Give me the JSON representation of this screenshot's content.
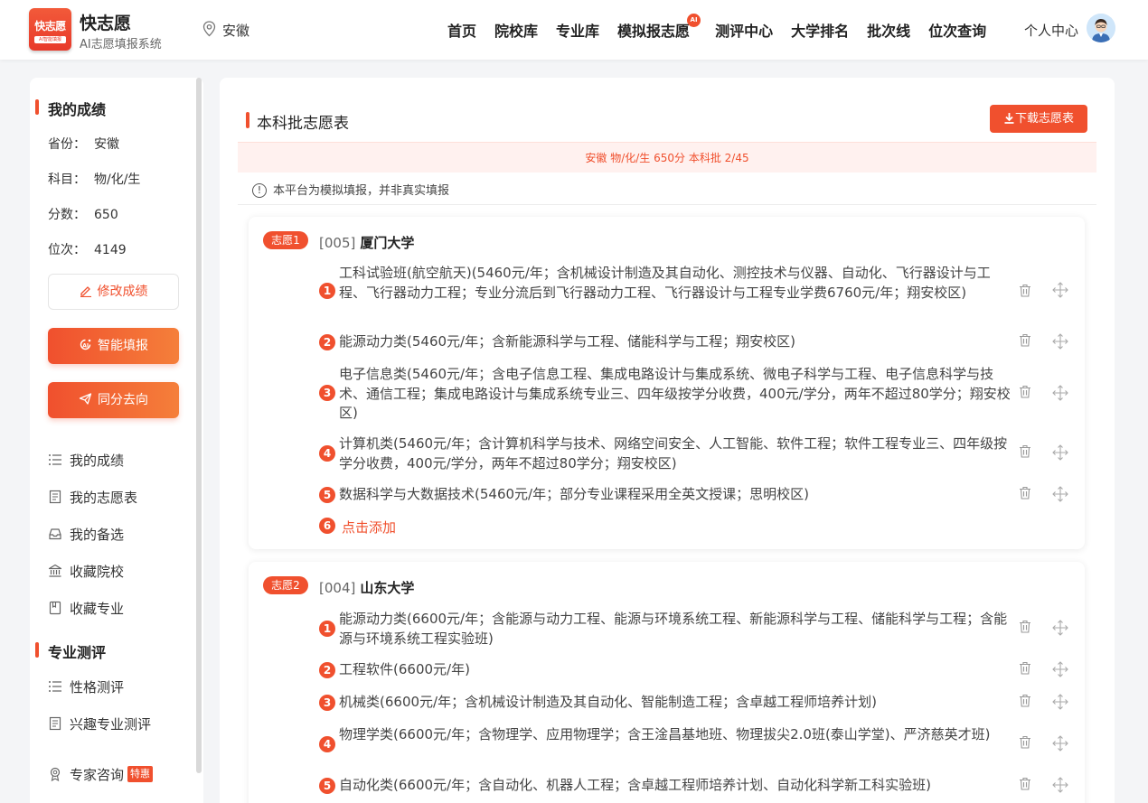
{
  "header": {
    "logo_line1": "快志愿",
    "logo_line2": "AI智能填报",
    "brand_name": "快志愿",
    "brand_sub": "AI志愿填报系统",
    "location": "安徽",
    "nav": [
      "首页",
      "院校库",
      "专业库",
      "模拟报志愿",
      "测评中心",
      "大学排名",
      "批次线",
      "位次查询"
    ],
    "nav_badge": "AI",
    "user_label": "个人中心"
  },
  "sidebar": {
    "score_title": "我的成绩",
    "province_key": "省份：",
    "province_val": "安徽",
    "subject_key": "科目：",
    "subject_val": "物/化/生",
    "score_key": "分数：",
    "score_val": "650",
    "rank_key": "位次：",
    "rank_val": "4149",
    "edit_btn": "修改成绩",
    "smart_btn": "智能填报",
    "peer_btn": "同分去向",
    "menu1": [
      "我的成绩",
      "我的志愿表",
      "我的备选",
      "收藏院校",
      "收藏专业"
    ],
    "eval_title": "专业测评",
    "menu2": [
      "性格测评",
      "兴趣专业测评"
    ],
    "expert": "专家咨询",
    "expert_tag": "特惠"
  },
  "main": {
    "title": "本科批志愿表",
    "download_btn": "下载志愿表",
    "banner": "安徽 物/化/生 650分 本科批 2/45",
    "notice_icon": "!",
    "notice": "本平台为模拟填报，并非真实填报",
    "cards": [
      {
        "tag": "志愿1",
        "code": "[005]",
        "name": "厦门大学",
        "majors": [
          {
            "n": "1",
            "text": "工科试验班(航空航天)(5460元/年；含机械设计制造及其自动化、测控技术与仪器、自动化、飞行器设计与工程、飞行器动力工程；专业分流后到飞行器动力工程、飞行器设计与工程专业学费6760元/年；翔安校区)"
          },
          {
            "n": "2",
            "text": "能源动力类(5460元/年；含新能源科学与工程、储能科学与工程；翔安校区)"
          },
          {
            "n": "3",
            "text": "电子信息类(5460元/年；含电子信息工程、集成电路设计与集成系统、微电子科学与工程、电子信息科学与技术、通信工程；集成电路设计与集成系统专业三、四年级按学分收费，400元/学分，两年不超过80学分；翔安校区)"
          },
          {
            "n": "4",
            "text": "计算机类(5460元/年；含计算机科学与技术、网络空间安全、人工智能、软件工程；软件工程专业三、四年级按学分收费，400元/学分，两年不超过80学分；翔安校区)"
          },
          {
            "n": "5",
            "text": "数据科学与大数据技术(5460元/年；部分专业课程采用全英文授课；思明校区)"
          }
        ],
        "add_n": "6",
        "add_text": "点击添加"
      },
      {
        "tag": "志愿2",
        "code": "[004]",
        "name": "山东大学",
        "majors": [
          {
            "n": "1",
            "text": "能源动力类(6600元/年；含能源与动力工程、能源与环境系统工程、新能源科学与工程、储能科学与工程；含能源与环境系统工程实验班)"
          },
          {
            "n": "2",
            "text": "工程软件(6600元/年)"
          },
          {
            "n": "3",
            "text": "机械类(6600元/年；含机械设计制造及其自动化、智能制造工程；含卓越工程师培养计划)"
          },
          {
            "n": "4",
            "text": "物理学类(6600元/年；含物理学、应用物理学；含王淦昌基地班、物理拔尖2.0班(泰山学堂)、严济慈英才班)"
          },
          {
            "n": "5",
            "text": "自动化类(6600元/年；含自动化、机器人工程；含卓越工程师培养计划、自动化科学新工科实验班)"
          }
        ]
      }
    ]
  }
}
